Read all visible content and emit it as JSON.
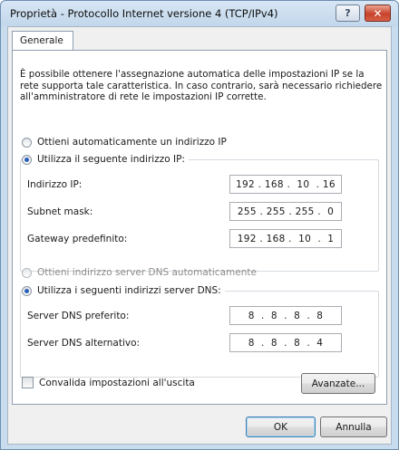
{
  "window": {
    "title": "Proprietà - Protocollo Internet versione 4 (TCP/IPv4)",
    "help_glyph": "?",
    "close_glyph": "✕"
  },
  "tabs": [
    {
      "label": "Generale",
      "active": true
    }
  ],
  "description": "È possibile ottenere l'assegnazione automatica delle impostazioni IP se la rete supporta tale caratteristica. In caso contrario, sarà necessario richiedere all'amministratore di rete le impostazioni IP corrette.",
  "ip_section": {
    "auto_option": {
      "label": "Ottieni automaticamente un indirizzo IP",
      "selected": false
    },
    "manual_option": {
      "label": "Utilizza il seguente indirizzo IP:",
      "selected": true
    },
    "fields": [
      {
        "label": "Indirizzo IP:",
        "value": "192 . 168 .  10  . 16"
      },
      {
        "label": "Subnet mask:",
        "value": "255 . 255 . 255 .  0"
      },
      {
        "label": "Gateway predefinito:",
        "value": "192 . 168 .  10  .  1"
      }
    ]
  },
  "dns_section": {
    "auto_option": {
      "label": "Ottieni indirizzo server DNS automaticamente",
      "selected": false,
      "enabled": false
    },
    "manual_option": {
      "label": "Utilizza i seguenti indirizzi server DNS:",
      "selected": true
    },
    "fields": [
      {
        "label": "Server DNS preferito:",
        "value": "8  .  8  .  8  .  8"
      },
      {
        "label": "Server DNS alternativo:",
        "value": "8  .  8  .  8  .  4"
      }
    ]
  },
  "validate_checkbox": {
    "label": "Convalida impostazioni all'uscita",
    "checked": false
  },
  "buttons": {
    "advanced": "Avanzate...",
    "ok": "OK",
    "cancel": "Annulla"
  }
}
